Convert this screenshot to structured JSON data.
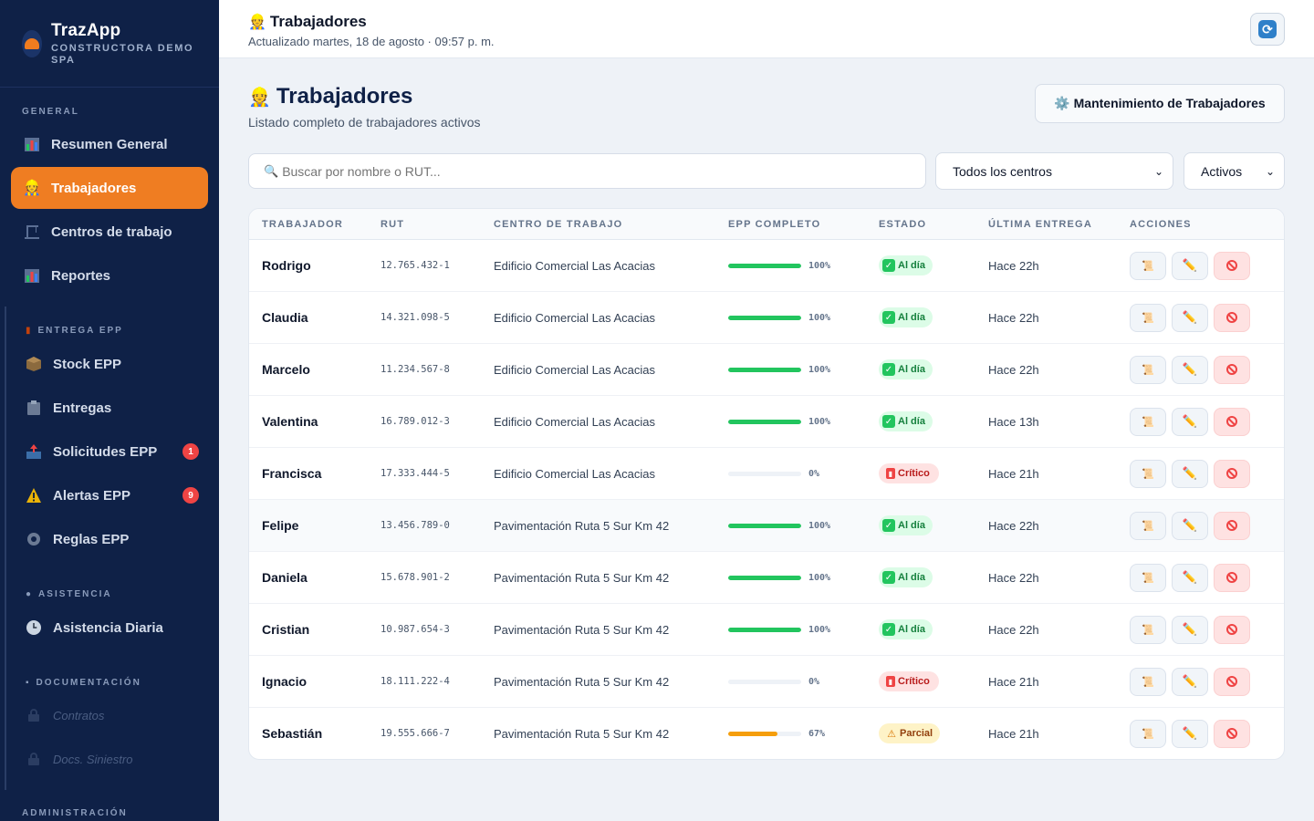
{
  "app": {
    "name": "TrazApp",
    "company": "CONSTRUCTORA DEMO SPA"
  },
  "sidebar": {
    "sections": {
      "general": "GENERAL",
      "entrega": "ENTREGA EPP",
      "asistencia": "ASISTENCIA",
      "documentacion": "DOCUMENTACIÓN",
      "administracion": "ADMINISTRACIÓN"
    },
    "items": {
      "resumen": "Resumen General",
      "trabajadores": "Trabajadores",
      "centros": "Centros de trabajo",
      "reportes": "Reportes",
      "stock": "Stock EPP",
      "entregas": "Entregas",
      "solicitudes": "Solicitudes EPP",
      "alertas": "Alertas EPP",
      "reglas": "Reglas EPP",
      "asistencia_diaria": "Asistencia Diaria",
      "contratos": "Contratos",
      "siniestro": "Docs. Siniestro"
    },
    "badges": {
      "solicitudes": "1",
      "alertas": "9"
    }
  },
  "topbar": {
    "title": "Trabajadores",
    "updated": "Actualizado martes, 18 de agosto · 09:57 p. m."
  },
  "page": {
    "title": "Trabajadores",
    "subtitle": "Listado completo de trabajadores activos",
    "maintenance_button": "⚙️ Mantenimiento de Trabajadores"
  },
  "filters": {
    "search_placeholder": "Buscar por nombre o RUT...",
    "centro_selected": "Todos los centros",
    "estado_selected": "Activos"
  },
  "table": {
    "headers": {
      "trabajador": "TRABAJADOR",
      "rut": "RUT",
      "centro": "CENTRO DE TRABAJO",
      "epp": "EPP COMPLETO",
      "estado": "ESTADO",
      "ultima": "ÚLTIMA ENTREGA",
      "acciones": "ACCIONES"
    },
    "rows": [
      {
        "name": "Rodrigo",
        "rut": "12.765.432-1",
        "centro": "Edificio Comercial Las Acacias",
        "epp_pct": "100%",
        "epp_value": 100,
        "estado": "Al día",
        "ultima": "Hace 22h"
      },
      {
        "name": "Claudia",
        "rut": "14.321.098-5",
        "centro": "Edificio Comercial Las Acacias",
        "epp_pct": "100%",
        "epp_value": 100,
        "estado": "Al día",
        "ultima": "Hace 22h"
      },
      {
        "name": "Marcelo",
        "rut": "11.234.567-8",
        "centro": "Edificio Comercial Las Acacias",
        "epp_pct": "100%",
        "epp_value": 100,
        "estado": "Al día",
        "ultima": "Hace 22h"
      },
      {
        "name": "Valentina",
        "rut": "16.789.012-3",
        "centro": "Edificio Comercial Las Acacias",
        "epp_pct": "100%",
        "epp_value": 100,
        "estado": "Al día",
        "ultima": "Hace 13h"
      },
      {
        "name": "Francisca",
        "rut": "17.333.444-5",
        "centro": "Edificio Comercial Las Acacias",
        "epp_pct": "0%",
        "epp_value": 0,
        "estado": "Crítico",
        "ultima": "Hace 21h"
      },
      {
        "name": "Felipe",
        "rut": "13.456.789-0",
        "centro": "Pavimentación Ruta 5 Sur Km 42",
        "epp_pct": "100%",
        "epp_value": 100,
        "estado": "Al día",
        "ultima": "Hace 22h"
      },
      {
        "name": "Daniela",
        "rut": "15.678.901-2",
        "centro": "Pavimentación Ruta 5 Sur Km 42",
        "epp_pct": "100%",
        "epp_value": 100,
        "estado": "Al día",
        "ultima": "Hace 22h"
      },
      {
        "name": "Cristian",
        "rut": "10.987.654-3",
        "centro": "Pavimentación Ruta 5 Sur Km 42",
        "epp_pct": "100%",
        "epp_value": 100,
        "estado": "Al día",
        "ultima": "Hace 22h"
      },
      {
        "name": "Ignacio",
        "rut": "18.111.222-4",
        "centro": "Pavimentación Ruta 5 Sur Km 42",
        "epp_pct": "0%",
        "epp_value": 0,
        "estado": "Crítico",
        "ultima": "Hace 21h"
      },
      {
        "name": "Sebastián",
        "rut": "19.555.666-7",
        "centro": "Pavimentación Ruta 5 Sur Km 42",
        "epp_pct": "67%",
        "epp_value": 67,
        "estado": "Parcial",
        "ultima": "Hace 21h"
      }
    ]
  },
  "colors": {
    "sidebar_bg": "#0f2147",
    "accent": "#ef7d22",
    "ok": "#22c55e",
    "partial": "#f59e0b",
    "critical": "#ef4444"
  }
}
